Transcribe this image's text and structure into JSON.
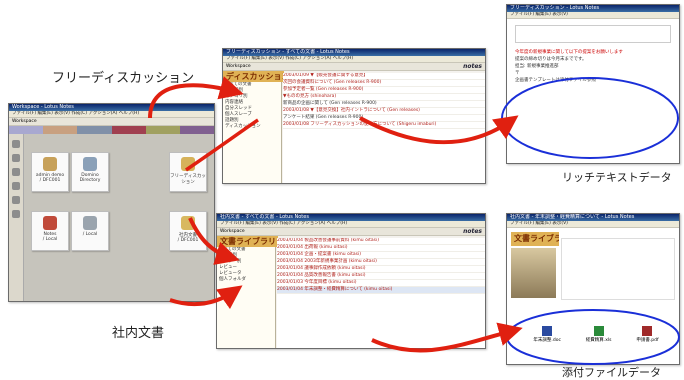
{
  "labels": {
    "free_discussion": "フリーディスカッション",
    "internal_docs": "社内文書",
    "rich_text": "リッチテキストデータ",
    "attachment": "添付ファイルデータ"
  },
  "workspace": {
    "title": "Workspace - Lotus Notes",
    "menu": "ファイル(F)  編集(E)  表示(V)  作成(C)  アクション(A)  ヘルプ(H)",
    "tab": "Workspace",
    "tiles": [
      {
        "line1": "admin demo",
        "line2": "/ DFC001",
        "color": "#c7a15a"
      },
      {
        "line1": "Domino",
        "line2": "Directory",
        "color": "#8aa0b8"
      },
      {
        "line1": "フリーディスカッ",
        "line2": "ション",
        "color": "#d6b25a"
      },
      {
        "line1": "Notes",
        "line2": "/ Local",
        "color": "#c04a3a"
      },
      {
        "line1": "",
        "line2": "/ Local",
        "color": "#9aa4ae"
      },
      {
        "line1": "社内文書",
        "line2": "/ DFC001",
        "color": "#d8b860"
      }
    ]
  },
  "discussion": {
    "title": "フリーディスカッション - すべての文書 - Lotus Notes",
    "menu": "ファイル(F)  編集(E)  表示(V)  作成(C)  アクション(A)  ヘルプ(H)",
    "notes": "notes",
    "header": "ディスカッション",
    "nav": [
      "すべての文書",
      "作成者別",
      "カテゴリ別",
      "内容連絡",
      "自分スレッド",
      "個人スレーブ",
      "話題別",
      "ディスカッション"
    ],
    "rows": [
      {
        "date": "2003/01/09",
        "text": "▼【販売会議に関する意見】",
        "cls": "red"
      },
      {
        "date": "",
        "text": "次回の会議資料について (Gen releases R-900)",
        "cls": "red"
      },
      {
        "date": "",
        "text": "参加予定者一覧 (Gen releases R-900)",
        "cls": "red"
      },
      {
        "date": "",
        "text": "▼ものの見方 (shinohara)",
        "cls": "red"
      },
      {
        "date": "",
        "text": "新商品の企画に関して (Gen releases R-900)",
        "cls": "dark"
      },
      {
        "date": "2003/01/08",
        "text": "▼【意見交換】社内イントラについて (Gen releases)",
        "cls": "red"
      },
      {
        "date": "",
        "text": "アンケート結果 (Gen releases R-900)",
        "cls": "dark"
      },
      {
        "date": "2003/01/08",
        "text": "フリーディスカッションの使い方について (Shigeru imaburi)",
        "cls": "red"
      }
    ]
  },
  "docs": {
    "title": "社内文書 - すべての文書 - Lotus Notes",
    "menu": "ファイル(F)  編集(E)  表示(V)  作成(C)  アクション(A)  ヘルプ(H)",
    "notes": "notes",
    "header": "文書ライブラリ",
    "nav": [
      "すべての文書",
      "作成者別",
      "ユーザー別",
      "レビュー",
      "レビュータ",
      "個人フォルダ"
    ],
    "rows": [
      {
        "date": "2003/01/04",
        "text": "製品改善会議事前資料 (kimu oitasi)"
      },
      {
        "date": "2003/01/04",
        "text": "出荷報 (kimu oitasi)"
      },
      {
        "date": "2003/01/04",
        "text": "企画・提案書 (kimu oitasi)"
      },
      {
        "date": "2003/01/04",
        "text": "2003年新規事業計画 (kimu oitasi)"
      },
      {
        "date": "2003/01/04",
        "text": "議事録作成依頼 (kimu oitasi)"
      },
      {
        "date": "2003/01/04",
        "text": "品質改善報告書 (kimu oitasi)"
      },
      {
        "date": "2003/01/03",
        "text": "今年度目標 (kimu oitasi)"
      },
      {
        "date": "2003/01/04",
        "text": "年末調整・経費精算について (kimu oitasi)"
      }
    ]
  },
  "richtext": {
    "title": "フリーディスカッション - Lotus Notes",
    "lines": [
      "今年度の新規事業に関して以下の提案をお願いします",
      "提案の締め切りは今月末までです。",
      "担当: 新規事業推進部",
      "〒",
      "企画書テンプレートは添付ファイル参照"
    ]
  },
  "attach": {
    "title": "社内文書 - 年末調整・経費精算について - Lotus Notes",
    "header": "文書ライブラリ",
    "files": [
      "年末調整.doc",
      "経費精算.xls",
      "申請書.pdf"
    ]
  }
}
